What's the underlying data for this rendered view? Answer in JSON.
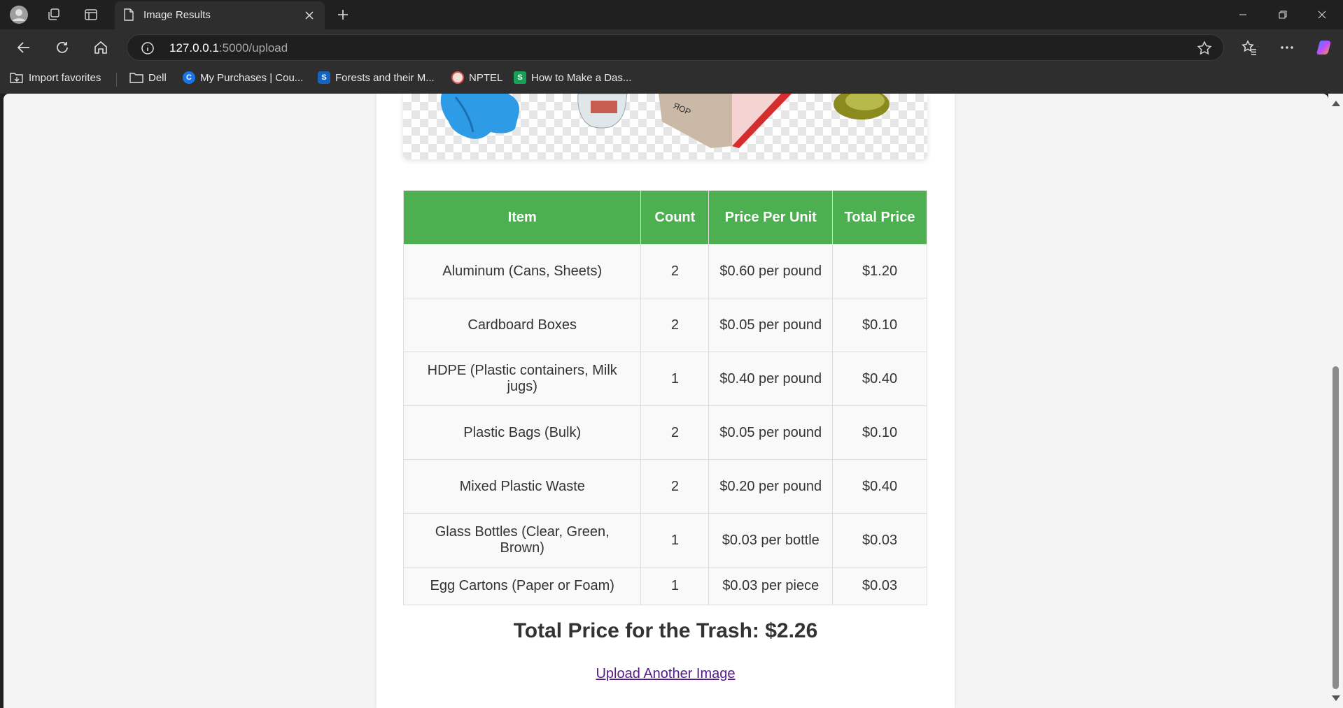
{
  "browser": {
    "tab_title": "Image Results",
    "url_host": "127.0.0.1",
    "url_path": ":5000/upload",
    "bookmarks": [
      {
        "label": "Import favorites"
      },
      {
        "label": "Dell"
      },
      {
        "label": "My Purchases | Cou..."
      },
      {
        "label": "Forests and their M..."
      },
      {
        "label": "NPTEL"
      },
      {
        "label": "How to Make a Das..."
      }
    ]
  },
  "results": {
    "headers": [
      "Item",
      "Count",
      "Price Per Unit",
      "Total Price"
    ],
    "rows": [
      {
        "item": "Aluminum (Cans, Sheets)",
        "count": "2",
        "price_per_unit": "$0.60 per pound",
        "total": "$1.20"
      },
      {
        "item": "Cardboard Boxes",
        "count": "2",
        "price_per_unit": "$0.05 per pound",
        "total": "$0.10"
      },
      {
        "item": "HDPE (Plastic containers, Milk jugs)",
        "count": "1",
        "price_per_unit": "$0.40 per pound",
        "total": "$0.40"
      },
      {
        "item": "Plastic Bags (Bulk)",
        "count": "2",
        "price_per_unit": "$0.05 per pound",
        "total": "$0.10"
      },
      {
        "item": "Mixed Plastic Waste",
        "count": "2",
        "price_per_unit": "$0.20 per pound",
        "total": "$0.40"
      },
      {
        "item": "Glass Bottles (Clear, Green, Brown)",
        "count": "1",
        "price_per_unit": "$0.03 per bottle",
        "total": "$0.03"
      },
      {
        "item": "Egg Cartons (Paper or Foam)",
        "count": "1",
        "price_per_unit": "$0.03 per piece",
        "total": "$0.03"
      }
    ],
    "total_line": "Total Price for the Trash: $2.26",
    "upload_link": "Upload Another Image"
  },
  "colors": {
    "header_green": "#4caf50",
    "link_visited": "#551a8b"
  }
}
